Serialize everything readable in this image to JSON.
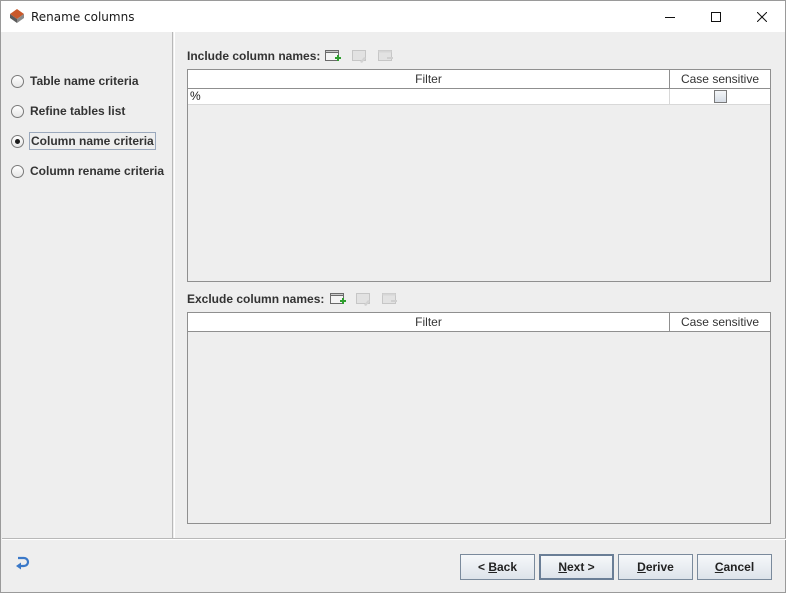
{
  "window": {
    "title": "Rename columns",
    "minimize_label": "—",
    "maximize_label": "□",
    "close_label": "✕"
  },
  "steps": [
    {
      "label": "Table name criteria",
      "selected": false
    },
    {
      "label": "Refine tables list",
      "selected": false
    },
    {
      "label": "Column name criteria",
      "selected": true
    },
    {
      "label": "Column rename criteria",
      "selected": false
    }
  ],
  "include": {
    "label": "Include column names:",
    "columns": {
      "filter": "Filter",
      "case_sensitive": "Case sensitive"
    },
    "rows": [
      {
        "filter": "%",
        "case_sensitive": false
      }
    ],
    "icons": [
      "add-filter-icon",
      "edit-filter-icon",
      "remove-filter-icon"
    ]
  },
  "exclude": {
    "label": "Exclude column names:",
    "columns": {
      "filter": "Filter",
      "case_sensitive": "Case sensitive"
    },
    "rows": [],
    "icons": [
      "add-filter-icon",
      "edit-filter-icon",
      "remove-filter-icon"
    ]
  },
  "buttons": {
    "back": {
      "mnemonic": "< ",
      "underlined": "B",
      "rest": "ack"
    },
    "next": {
      "underlined": "N",
      "rest": "ext >"
    },
    "derive": {
      "underlined": "D",
      "rest": "erive"
    },
    "cancel": {
      "underlined": "C",
      "rest": "ancel"
    }
  },
  "colors": {
    "accent_green": "#2e9e2e",
    "help_icon_blue": "#3a78c8",
    "window_bg": "#eeeeee"
  }
}
